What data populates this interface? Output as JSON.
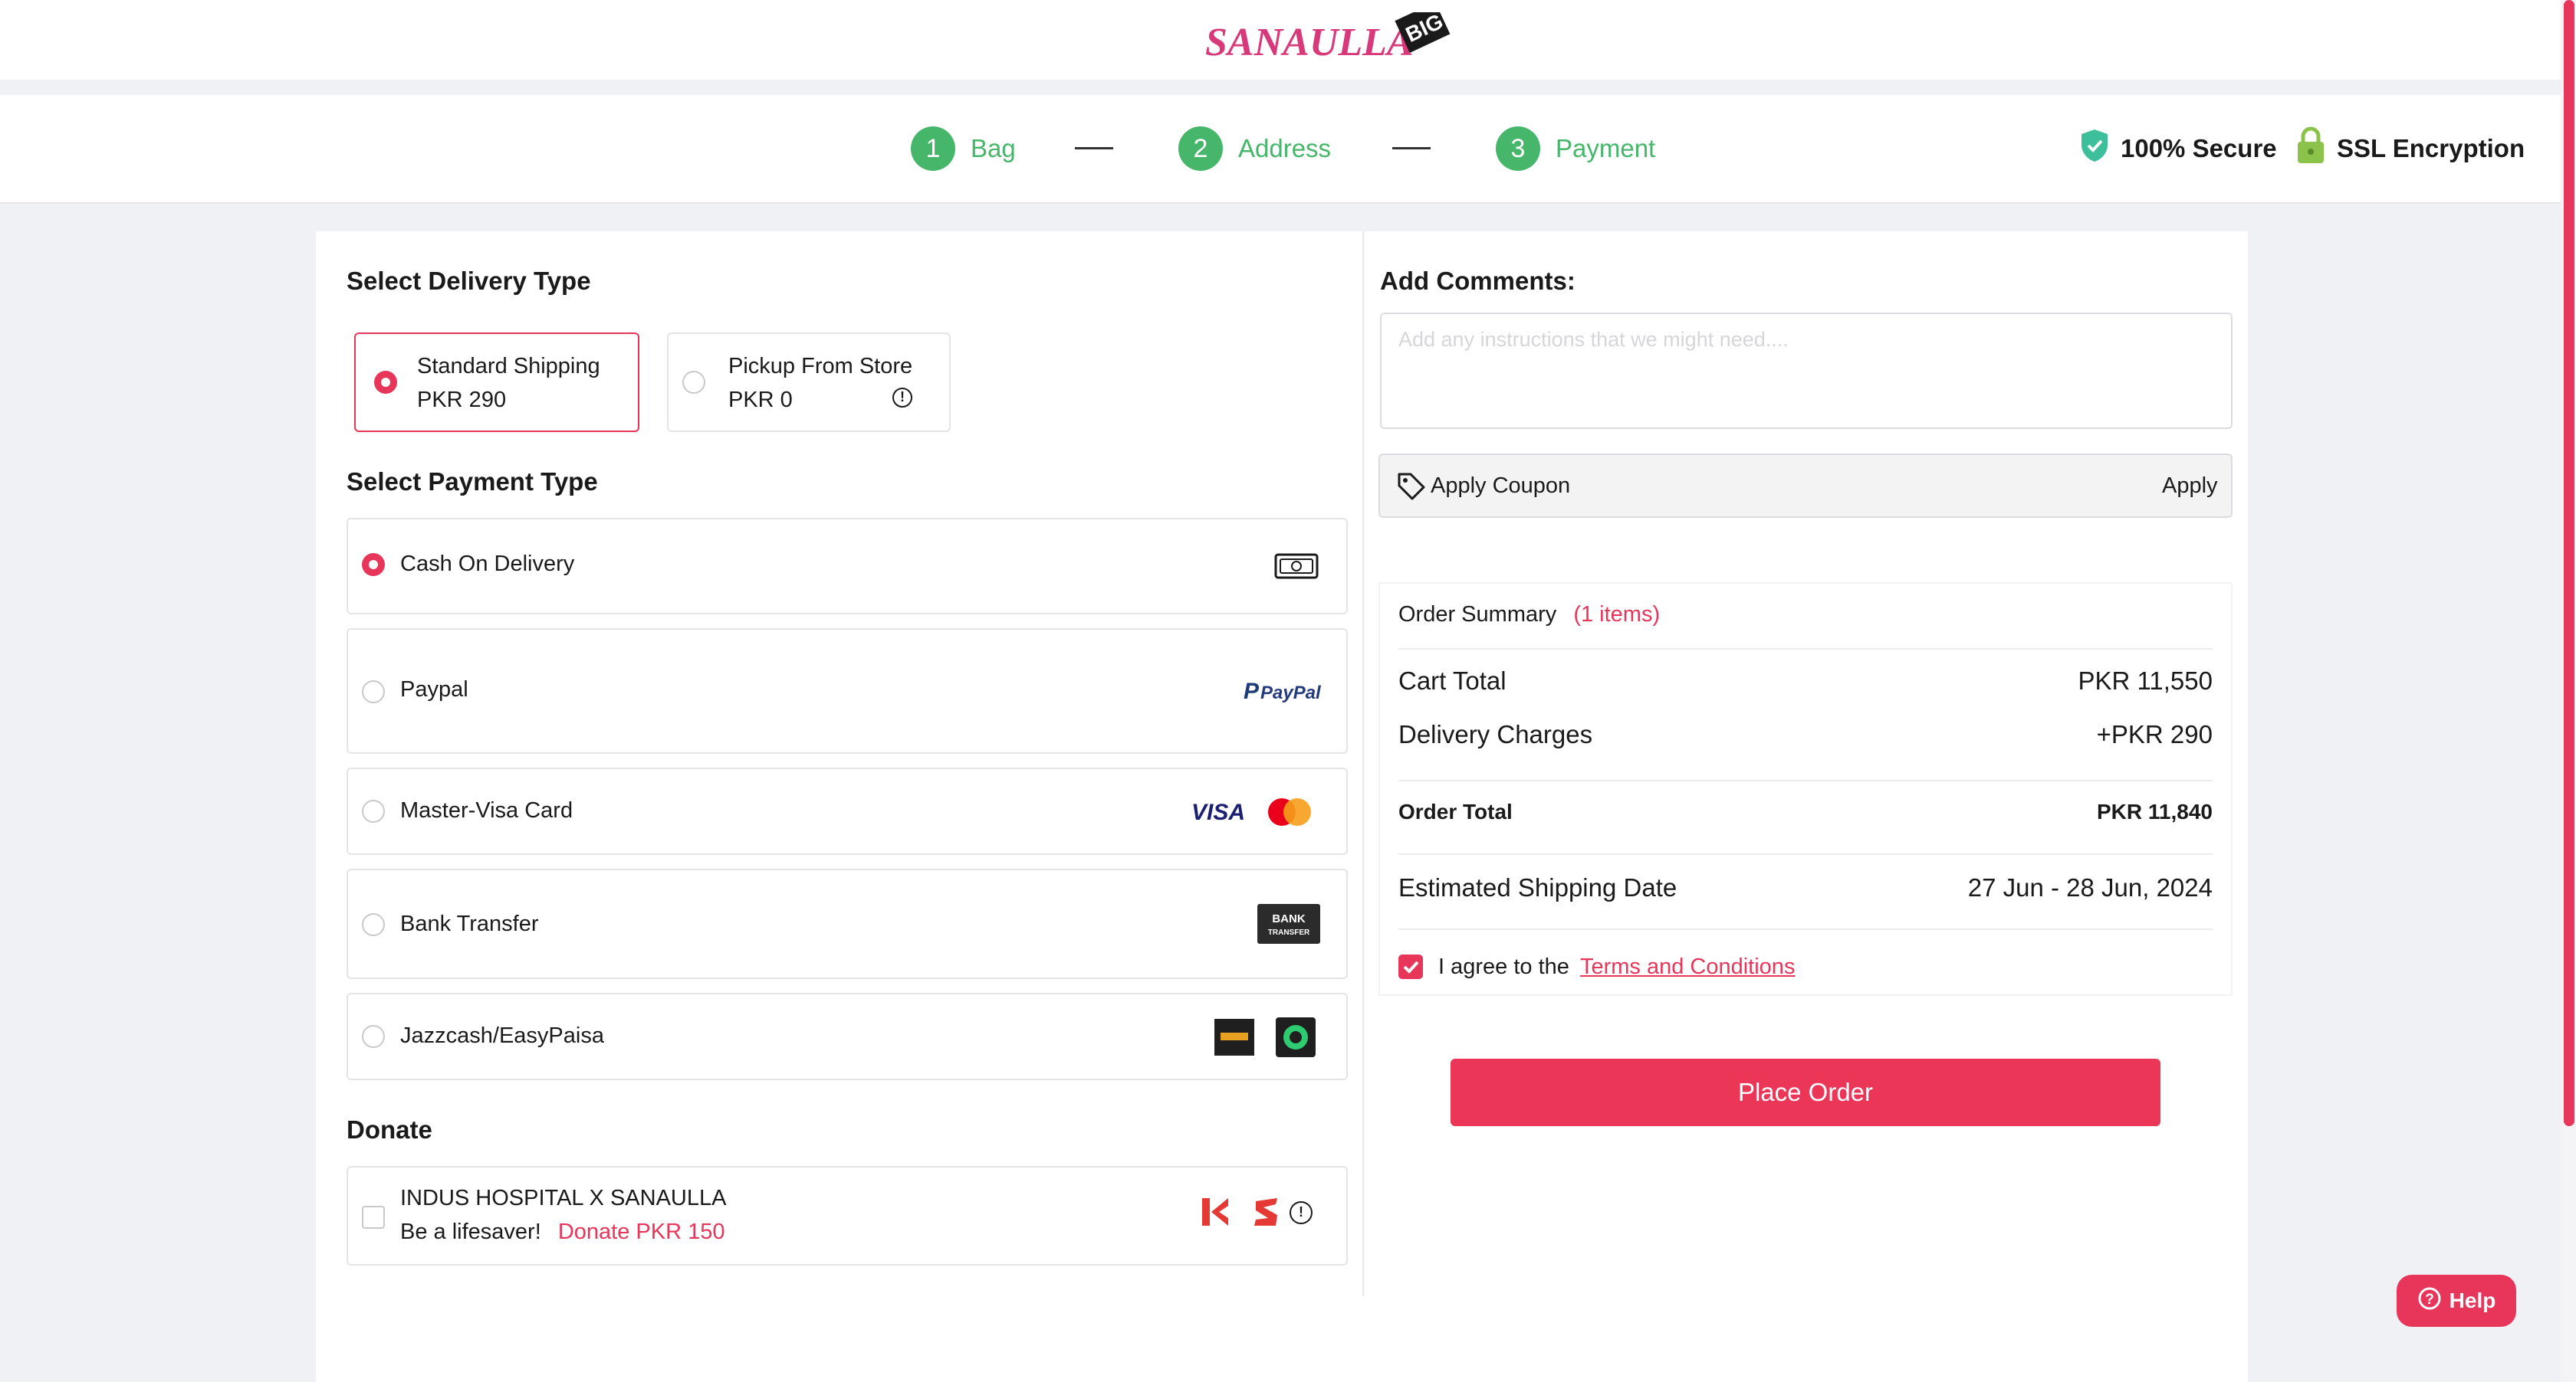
{
  "brand": {
    "name": "SANAULLA",
    "badge": "BIG"
  },
  "steps": [
    {
      "num": "1",
      "label": "Bag"
    },
    {
      "num": "2",
      "label": "Address"
    },
    {
      "num": "3",
      "label": "Payment"
    }
  ],
  "security": {
    "secure": "100% Secure",
    "ssl": "SSL Encryption"
  },
  "delivery": {
    "heading": "Select Delivery Type",
    "options": [
      {
        "label": "Standard Shipping",
        "price": "PKR 290",
        "selected": true
      },
      {
        "label": "Pickup From Store",
        "price": "PKR 0",
        "selected": false
      }
    ]
  },
  "payment": {
    "heading": "Select Payment Type",
    "options": [
      {
        "label": "Cash On Delivery",
        "icon": "cash-icon",
        "selected": true
      },
      {
        "label": "Paypal",
        "icon": "paypal-logo",
        "logo_text": "PayPal",
        "selected": false
      },
      {
        "label": "Master-Visa Card",
        "icon": "visa-mastercard-logo",
        "logo_text": "VISA",
        "selected": false
      },
      {
        "label": "Bank Transfer",
        "icon": "bank-transfer-logo",
        "logo_text": "BANK TRANSFER",
        "selected": false
      },
      {
        "label": "Jazzcash/EasyPaisa",
        "icon": "jazzcash-easypaisa-logo",
        "selected": false
      }
    ]
  },
  "donate": {
    "heading": "Donate",
    "title": "INDUS HOSPITAL X SANAULLA",
    "tagline": "Be a lifesaver!",
    "amount": "Donate PKR 150"
  },
  "comments": {
    "heading": "Add Comments:",
    "placeholder": "Add any instructions that we might need...."
  },
  "coupon": {
    "label": "Apply Coupon",
    "button": "Apply"
  },
  "summary": {
    "title": "Order Summary",
    "count": "(1 items)",
    "cart_total_label": "Cart Total",
    "cart_total": "PKR 11,550",
    "delivery_label": "Delivery Charges",
    "delivery": "+PKR 290",
    "order_total_label": "Order Total",
    "order_total": "PKR 11,840",
    "ship_date_label": "Estimated Shipping Date",
    "ship_date": "27 Jun - 28 Jun, 2024",
    "agree_text": "I agree to the",
    "terms_link": "Terms and Conditions"
  },
  "place_order": "Place Order",
  "help": "Help",
  "colors": {
    "accent": "#e8355a",
    "step_green": "#46b66b"
  }
}
